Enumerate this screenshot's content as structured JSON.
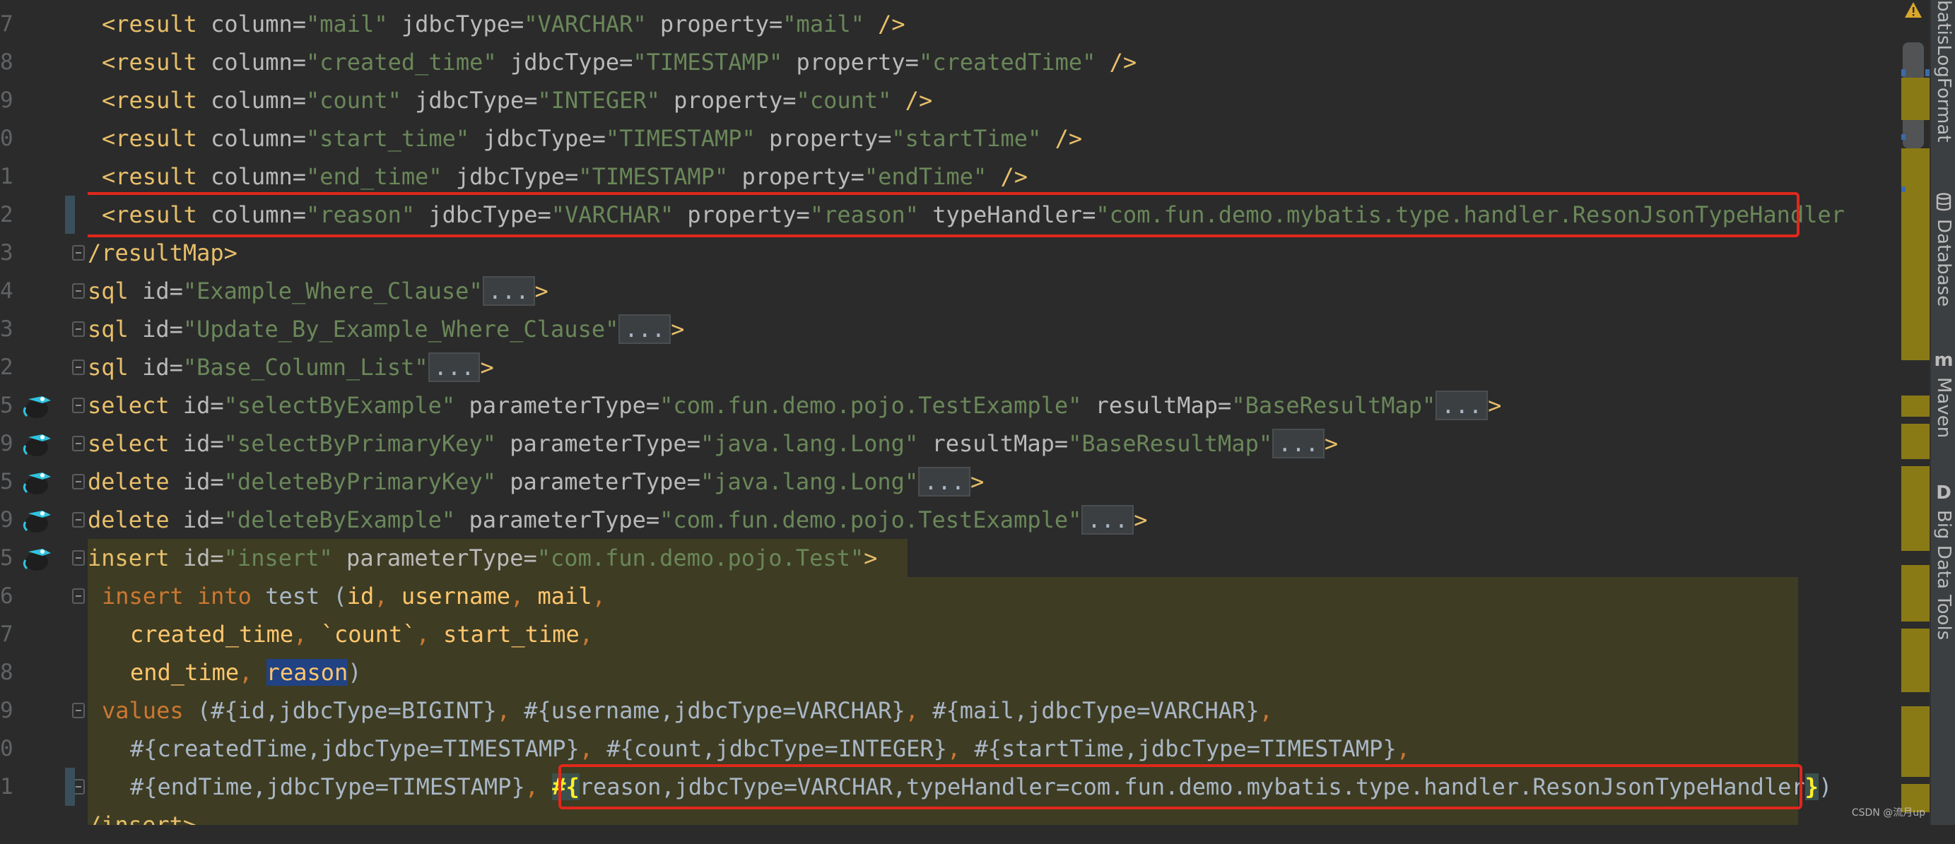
{
  "gutter": {
    "line_numbers": [
      "7",
      "8",
      "9",
      "0",
      "1",
      "2",
      "3",
      "4",
      "3",
      "2",
      "5",
      "9",
      "5",
      "9",
      "5",
      "6",
      "7",
      "8",
      "9",
      "0",
      "1",
      ""
    ]
  },
  "code": {
    "l1": {
      "open": "<result ",
      "a1": "column=",
      "v1": "\"mail\"",
      "a2": " jdbcType=",
      "v2": "\"VARCHAR\"",
      "a3": " property=",
      "v3": "\"mail\"",
      "close": " />"
    },
    "l2": {
      "open": "<result ",
      "a1": "column=",
      "v1": "\"created_time\"",
      "a2": " jdbcType=",
      "v2": "\"TIMESTAMP\"",
      "a3": " property=",
      "v3": "\"createdTime\"",
      "close": " />"
    },
    "l3": {
      "open": "<result ",
      "a1": "column=",
      "v1": "\"count\"",
      "a2": " jdbcType=",
      "v2": "\"INTEGER\"",
      "a3": " property=",
      "v3": "\"count\"",
      "close": " />"
    },
    "l4": {
      "open": "<result ",
      "a1": "column=",
      "v1": "\"start_time\"",
      "a2": " jdbcType=",
      "v2": "\"TIMESTAMP\"",
      "a3": " property=",
      "v3": "\"startTime\"",
      "close": " />"
    },
    "l5": {
      "open": "<result ",
      "a1": "column=",
      "v1": "\"end_time\"",
      "a2": " jdbcType=",
      "v2": "\"TIMESTAMP\"",
      "a3": " property=",
      "v3": "\"endTime\"",
      "close": " />"
    },
    "l6": {
      "open": "<result ",
      "a1": "column=",
      "v1": "\"reason\"",
      "a2": " jdbcType=",
      "v2": "\"VARCHAR\"",
      "a3": " property=",
      "v3": "\"reason\"",
      "a4": " typeHandler=",
      "v4": "\"com.fun.demo.mybatis.type.handler.ResonJsonTypeHandler"
    },
    "l7": {
      "tag": "/resultMap>"
    },
    "l8": {
      "tag": "sql ",
      "a1": "id=",
      "v1": "\"Example_Where_Clause\"",
      "fold": "...",
      "close": ">"
    },
    "l9": {
      "tag": "sql ",
      "a1": "id=",
      "v1": "\"Update_By_Example_Where_Clause\"",
      "fold": "...",
      "close": ">"
    },
    "l10": {
      "tag": "sql ",
      "a1": "id=",
      "v1": "\"Base_Column_List\"",
      "fold": "...",
      "close": ">"
    },
    "l11": {
      "tag": "select ",
      "a1": "id=",
      "v1": "\"selectByExample\"",
      "a2": " parameterType=",
      "v2": "\"com.fun.demo.pojo.TestExample\"",
      "a3": " resultMap=",
      "v3": "\"BaseResultMap\"",
      "fold": "...",
      "close": ">"
    },
    "l12": {
      "tag": "select ",
      "a1": "id=",
      "v1": "\"selectByPrimaryKey\"",
      "a2": " parameterType=",
      "v2": "\"java.lang.Long\"",
      "a3": " resultMap=",
      "v3": "\"BaseResultMap\"",
      "fold": "...",
      "close": ">"
    },
    "l13": {
      "tag": "delete ",
      "a1": "id=",
      "v1": "\"deleteByPrimaryKey\"",
      "a2": " parameterType=",
      "v2": "\"java.lang.Long\"",
      "fold": "...",
      "close": ">"
    },
    "l14": {
      "tag": "delete ",
      "a1": "id=",
      "v1": "\"deleteByExample\"",
      "a2": " parameterType=",
      "v2": "\"com.fun.demo.pojo.TestExample\"",
      "fold": "...",
      "close": ">"
    },
    "l15": {
      "tag": "insert ",
      "a1": "id=",
      "v1": "\"insert\"",
      "a2": " parameterType=",
      "v2": "\"com.fun.demo.pojo.Test\"",
      "close": ">"
    },
    "l16": {
      "kw1": "insert ",
      "kw2": "into",
      "p1": " test (",
      "c1": "id",
      ",1": ", ",
      "c2": "username",
      ",2": ", ",
      "c3": "mail",
      ",3": ","
    },
    "l17": {
      "c1": "created_time",
      ",1": ", ",
      "c2": "`count`",
      ",2": ", ",
      "c3": "start_time",
      ",3": ","
    },
    "l18": {
      "c1": "end_time",
      ",1": ", ",
      "c2": "reason",
      "p": ")"
    },
    "l19": {
      "kw": "values",
      "p1": " (",
      "e1": "#{id,jdbcType=BIGINT}",
      ",1": ", ",
      "e2": "#{username,jdbcType=VARCHAR}",
      ",2": ", ",
      "e3": "#{mail,jdbcType=VARCHAR}",
      ",3": ","
    },
    "l20": {
      "e1": "#{createdTime,jdbcType=TIMESTAMP}",
      ",1": ", ",
      "e2": "#{count,jdbcType=INTEGER}",
      ",2": ", ",
      "e3": "#{startTime,jdbcType=TIMESTAMP}",
      ",3": ","
    },
    "l21": {
      "e1": "#{endTime,jdbcType=TIMESTAMP}",
      ",1": ", ",
      "b1": "#{",
      "e2": "reason,jdbcType=VARCHAR,typeHandler=com.fun.demo.mybatis.type.handler.ResonJsonTypeHandler",
      "b2": "}",
      "p": ")"
    },
    "l22": {
      "tag": "/insert>"
    }
  },
  "right_panel": {
    "tools": [
      "batisLogFormat",
      "Database",
      "Maven",
      "Big Data Tools"
    ],
    "icons": [
      "database-icon",
      "maven-icon",
      "big-data-tools-icon"
    ]
  },
  "watermark": "CSDN @流月up",
  "colors": {
    "background": "#2b2b2b",
    "tag": "#e8bf6a",
    "string": "#6a8759",
    "keyword": "#cc7832",
    "field": "#ffc66d",
    "highlight": "#3e3c23",
    "annotation_box": "#e0281c"
  }
}
